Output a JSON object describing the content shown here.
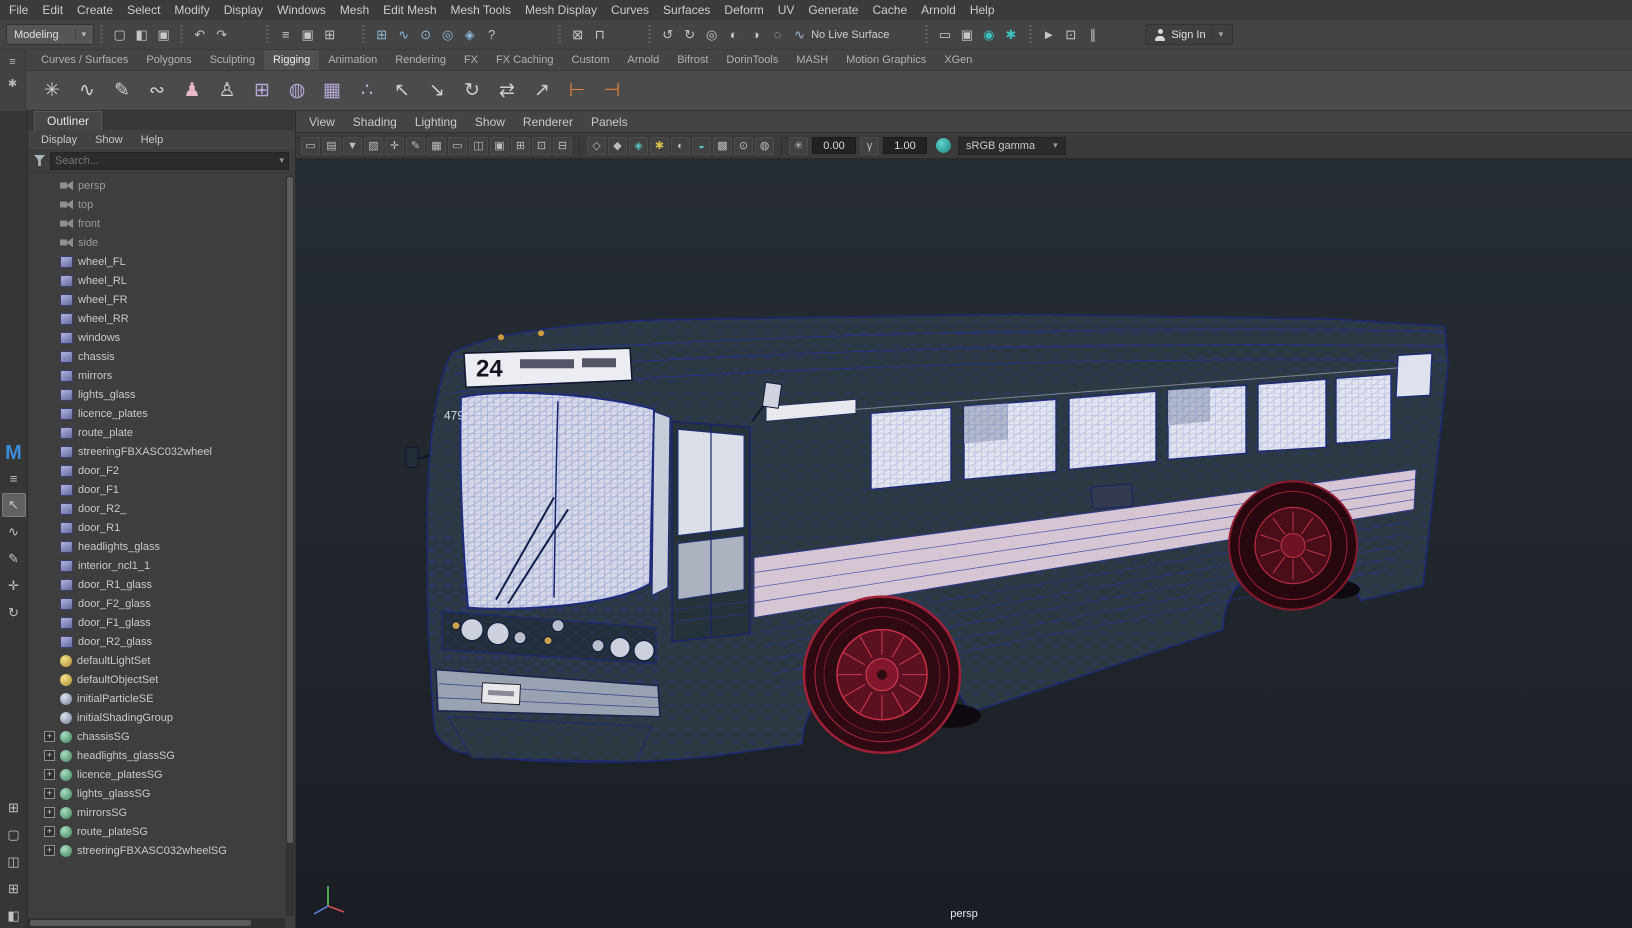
{
  "ui": {
    "caret_down": "▾",
    "logo": "M"
  },
  "menubar": {
    "items": [
      "File",
      "Edit",
      "Create",
      "Select",
      "Modify",
      "Display",
      "Windows",
      "Mesh",
      "Edit Mesh",
      "Mesh Tools",
      "Mesh Display",
      "Curves",
      "Surfaces",
      "Deform",
      "UV",
      "Generate",
      "Cache",
      "Arnold",
      "Help"
    ]
  },
  "statusline": {
    "workspace": "Modeling",
    "file_icons": [
      {
        "name": "new-scene-icon",
        "glyph": "▢"
      },
      {
        "name": "open-scene-icon",
        "glyph": "◧"
      },
      {
        "name": "save-scene-icon",
        "glyph": "▣"
      }
    ],
    "undo_icons": [
      {
        "name": "undo-icon",
        "glyph": "↶"
      },
      {
        "name": "redo-icon",
        "glyph": "↷"
      }
    ],
    "mask_icons": [
      {
        "name": "select-hierarchy-icon",
        "glyph": "≡"
      },
      {
        "name": "select-object-icon",
        "glyph": "▣"
      },
      {
        "name": "select-component-icon",
        "glyph": "⊞"
      }
    ],
    "snap_icons": [
      {
        "name": "snap-grid-icon",
        "glyph": "⊞",
        "tint": "#8fb8d8"
      },
      {
        "name": "snap-curve-icon",
        "glyph": "∿",
        "tint": "#8fb8d8"
      },
      {
        "name": "snap-point-icon",
        "glyph": "⊙",
        "tint": "#8fb8d8"
      },
      {
        "name": "snap-projected-center-icon",
        "glyph": "◎",
        "tint": "#8fb8d8"
      },
      {
        "name": "make-live-icon",
        "glyph": "◈",
        "tint": "#8fb8d8"
      },
      {
        "name": "quick-help-icon",
        "glyph": "?"
      }
    ],
    "history_icons": [
      {
        "name": "construction-history-icon",
        "glyph": "⊠"
      },
      {
        "name": "lock-selection-icon",
        "glyph": "⊓"
      }
    ],
    "construction_icons": [
      {
        "name": "snap-together-icon",
        "glyph": "↺"
      },
      {
        "name": "discrete-rotate-icon",
        "glyph": "↻"
      },
      {
        "name": "soft-select-icon",
        "glyph": "◎"
      },
      {
        "name": "reflection-icon",
        "glyph": "◐"
      },
      {
        "name": "symmetry-icon",
        "glyph": "◑"
      },
      {
        "name": "snap-release-icon",
        "glyph": "◌"
      }
    ],
    "live_surface": {
      "icon_glyph": "∿",
      "label": "No Live Surface"
    },
    "render_icons": [
      {
        "name": "render-view-icon",
        "glyph": "▭"
      },
      {
        "name": "render-current-frame-icon",
        "glyph": "▣"
      },
      {
        "name": "ipr-render-icon",
        "glyph": "◉",
        "tint": "#3ec1c1"
      },
      {
        "name": "render-settings-icon",
        "glyph": "✱",
        "tint": "#3ec1c1"
      }
    ],
    "playback_icons": [
      {
        "name": "sequence-render-icon",
        "glyph": "►"
      },
      {
        "name": "content-browser-icon",
        "glyph": "⊡"
      },
      {
        "name": "pause-icon",
        "glyph": "∥"
      }
    ],
    "sign_in": {
      "label": "Sign In"
    }
  },
  "shelf": {
    "side_icons": [
      {
        "name": "shelf-options-icon",
        "glyph": "≡"
      },
      {
        "name": "shelf-edit-icon",
        "glyph": "✱"
      }
    ],
    "tabs": [
      {
        "label": "Curves / Surfaces"
      },
      {
        "label": "Polygons"
      },
      {
        "label": "Sculpting"
      },
      {
        "label": "Rigging",
        "state": "active"
      },
      {
        "label": "Animation"
      },
      {
        "label": "Rendering"
      },
      {
        "label": "FX"
      },
      {
        "label": "FX Caching"
      },
      {
        "label": "Custom"
      },
      {
        "label": "Arnold"
      },
      {
        "label": "Bifrost"
      },
      {
        "label": "DorinTools"
      },
      {
        "label": "MASH"
      },
      {
        "label": "Motion Graphics"
      },
      {
        "label": "XGen"
      }
    ],
    "icons": [
      {
        "name": "create-locator-icon",
        "glyph": "✳",
        "tint": "#cfcfcf"
      },
      {
        "name": "ep-curve-icon",
        "glyph": "∿",
        "tint": "#cfcfcf"
      },
      {
        "name": "pencil-curve-icon",
        "glyph": "✎",
        "tint": "#cfcfcf"
      },
      {
        "name": "attach-curve-icon",
        "glyph": "∾",
        "tint": "#cfcfcf"
      },
      {
        "name": "create-joints-icon",
        "glyph": "♟",
        "tint": "#e8b8c8"
      },
      {
        "name": "ik-handle-icon",
        "glyph": "♙",
        "tint": "#d8d8d8"
      },
      {
        "name": "lattice-icon",
        "glyph": "⊞",
        "tint": "#b8a8d8"
      },
      {
        "name": "sphere-lattice-icon",
        "glyph": "◍",
        "tint": "#b8a8d8"
      },
      {
        "name": "cube-lattice-icon",
        "glyph": "▦",
        "tint": "#b8a8d8"
      },
      {
        "name": "cluster-icon",
        "glyph": "∴",
        "tint": "#b8a8d8"
      },
      {
        "name": "parent-constraint-icon",
        "glyph": "↖",
        "tint": "#cfcfcf"
      },
      {
        "name": "point-constraint-icon",
        "glyph": "↘",
        "tint": "#cfcfcf"
      },
      {
        "name": "orient-constraint-icon",
        "glyph": "↻",
        "tint": "#cfcfcf"
      },
      {
        "name": "aim-constraint-icon",
        "glyph": "⇄",
        "tint": "#cfcfcf"
      },
      {
        "name": "scale-constraint-icon",
        "glyph": "↗",
        "tint": "#cfcfcf"
      },
      {
        "name": "pin-constraint-icon",
        "glyph": "⊢",
        "tint": "#e0813c"
      },
      {
        "name": "unpin-constraint-icon",
        "glyph": "⊣",
        "tint": "#e0813c"
      }
    ]
  },
  "toolbox": {
    "items": [
      {
        "name": "toolbox-menu-icon",
        "glyph": "≡"
      },
      {
        "name": "select-tool-icon",
        "glyph": "↖",
        "state": "active"
      },
      {
        "name": "lasso-tool-icon",
        "glyph": "∿"
      },
      {
        "name": "paint-select-tool-icon",
        "glyph": "✎"
      },
      {
        "name": "move-tool-icon",
        "glyph": "✛"
      },
      {
        "name": "rotate-tool-icon",
        "glyph": "↻"
      },
      {
        "name": "scale-tool-icon",
        "glyph": "⊞"
      },
      {
        "name": "layout-single-pane-icon",
        "glyph": "▢"
      },
      {
        "name": "layout-two-panes-icon",
        "glyph": "◫"
      },
      {
        "name": "layout-four-panes-icon",
        "glyph": "⊞"
      },
      {
        "name": "layout-persp-outliner-icon",
        "glyph": "◧"
      }
    ]
  },
  "outliner": {
    "title": "Outliner",
    "menus": [
      "Display",
      "Show",
      "Help"
    ],
    "search_placeholder": "Search...",
    "items": [
      {
        "type": "camera",
        "label": "persp"
      },
      {
        "type": "camera",
        "label": "top"
      },
      {
        "type": "camera",
        "label": "front"
      },
      {
        "type": "camera",
        "label": "side"
      },
      {
        "type": "mesh",
        "label": "wheel_FL"
      },
      {
        "type": "mesh",
        "label": "wheel_RL"
      },
      {
        "type": "mesh",
        "label": "wheel_FR"
      },
      {
        "type": "mesh",
        "label": "wheel_RR"
      },
      {
        "type": "mesh",
        "label": "windows"
      },
      {
        "type": "mesh",
        "label": "chassis"
      },
      {
        "type": "mesh",
        "label": "mirrors"
      },
      {
        "type": "mesh",
        "label": "lights_glass"
      },
      {
        "type": "mesh",
        "label": "licence_plates"
      },
      {
        "type": "mesh",
        "label": "route_plate"
      },
      {
        "type": "mesh",
        "label": "streeringFBXASC032wheel"
      },
      {
        "type": "mesh",
        "label": "door_F2"
      },
      {
        "type": "mesh",
        "label": "door_F1"
      },
      {
        "type": "mesh",
        "label": "door_R2_"
      },
      {
        "type": "mesh",
        "label": "door_R1"
      },
      {
        "type": "mesh",
        "label": "headlights_glass"
      },
      {
        "type": "mesh",
        "label": "interior_ncl1_1"
      },
      {
        "type": "mesh",
        "label": "door_R1_glass"
      },
      {
        "type": "mesh",
        "label": "door_F2_glass"
      },
      {
        "type": "mesh",
        "label": "door_F1_glass"
      },
      {
        "type": "mesh",
        "label": "door_R2_glass"
      },
      {
        "type": "set",
        "label": "defaultLightSet"
      },
      {
        "type": "set",
        "label": "defaultObjectSet"
      },
      {
        "type": "se",
        "label": "initialParticleSE"
      },
      {
        "type": "se",
        "label": "initialShadingGroup"
      },
      {
        "type": "sg",
        "label": "chassisSG"
      },
      {
        "type": "sg",
        "label": "headlights_glassSG"
      },
      {
        "type": "sg",
        "label": "licence_platesSG"
      },
      {
        "type": "sg",
        "label": "lights_glassSG"
      },
      {
        "type": "sg",
        "label": "mirrorsSG"
      },
      {
        "type": "sg",
        "label": "route_plateSG"
      },
      {
        "type": "sg",
        "label": "streeringFBXASC032wheelSG"
      }
    ]
  },
  "viewport": {
    "menus": [
      "View",
      "Shading",
      "Lighting",
      "Show",
      "Renderer",
      "Panels"
    ],
    "left_icons": [
      {
        "name": "select-camera-icon",
        "glyph": "▭"
      },
      {
        "name": "camera-attributes-icon",
        "glyph": "▤"
      },
      {
        "name": "bookmarks-icon",
        "glyph": "▼"
      },
      {
        "name": "image-plane-icon",
        "glyph": "▧"
      },
      {
        "name": "2d-pan-zoom-icon",
        "glyph": "✛"
      },
      {
        "name": "grease-pencil-icon",
        "glyph": "✎"
      },
      {
        "name": "grid-icon",
        "glyph": "▦"
      },
      {
        "name": "film-gate-icon",
        "glyph": "▭"
      },
      {
        "name": "resolution-gate-icon",
        "glyph": "◫"
      },
      {
        "name": "gate-mask-icon",
        "glyph": "▣"
      },
      {
        "name": "field-chart-icon",
        "glyph": "⊞"
      },
      {
        "name": "safe-action-icon",
        "glyph": "⊡"
      },
      {
        "name": "safe-title-icon",
        "glyph": "⊟"
      }
    ],
    "shading_icons": [
      {
        "name": "wireframe-icon",
        "glyph": "◇"
      },
      {
        "name": "shaded-icon",
        "glyph": "◆"
      },
      {
        "name": "textured-icon",
        "glyph": "◈",
        "tint": "#58c0c0"
      },
      {
        "name": "use-all-lights-icon",
        "glyph": "✱",
        "tint": "#d8c050"
      },
      {
        "name": "shadows-icon",
        "glyph": "◐"
      },
      {
        "name": "ambient-occlusion-icon",
        "glyph": "◒",
        "tint": "#58c0c0"
      },
      {
        "name": "anti-alias-icon",
        "glyph": "▩"
      },
      {
        "name": "isolate-select-icon",
        "glyph": "⊙"
      },
      {
        "name": "xray-icon",
        "glyph": "◍"
      }
    ],
    "exposure_icon_glyph": "✳",
    "gamma_icon_glyph": "γ",
    "exposure_label": "0.00",
    "gamma_label": "1.00",
    "color_transform": "sRGB gamma",
    "scene": {
      "front_sign": "24",
      "fleet_number": "479",
      "camera_label": "persp"
    }
  }
}
